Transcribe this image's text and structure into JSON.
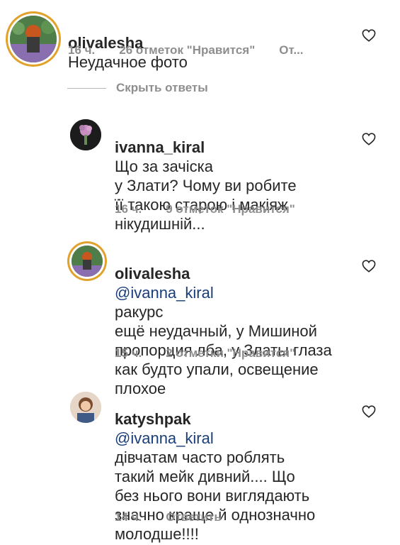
{
  "comments": [
    {
      "username": "olivalesha",
      "mention": "",
      "text": "Неудачное фото",
      "time": "16 ч.",
      "likes": "26 отметок \"Нравится\"",
      "action": "От...",
      "avatar_icon": "profile-photo-icon"
    },
    {
      "username": "ivanna_kiral",
      "mention": "",
      "text": "Що за зачіска\nу Злати? Чому ви робите\nїї такою старою і макіяж\nнікудишній...",
      "time": "16 ч.",
      "likes": "9 отметок \"Нравится\"",
      "action": "",
      "avatar_icon": "profile-photo-icon"
    },
    {
      "username": "olivalesha",
      "mention": "@ivanna_kiral",
      "text": "ракурс\nещё неудачный, у Мишиной\nпропорция лба, у Златы глаза\nкак будто упали, освещение\nплохое",
      "time": "15 ч.",
      "likes": "2 отметки \"Нравится\"",
      "action": "",
      "avatar_icon": "profile-photo-icon"
    },
    {
      "username": "katyshpak",
      "mention": "@ivanna_kiral",
      "text": "\nдівчатам часто роблять\nтакий мейк дивний.... Що\nбез нього вони виглядають\nзначно краще й однозначно\nмолодше!!!!",
      "time": "14 ч.",
      "likes": "",
      "action": "Ответить",
      "avatar_icon": "profile-photo-icon"
    }
  ],
  "hide_replies_label": "Скрыть ответы",
  "colors": {
    "text": "#262626",
    "muted": "#8e8e8e",
    "mention": "#1a3e7a",
    "story_ring": "#e0a22a"
  }
}
